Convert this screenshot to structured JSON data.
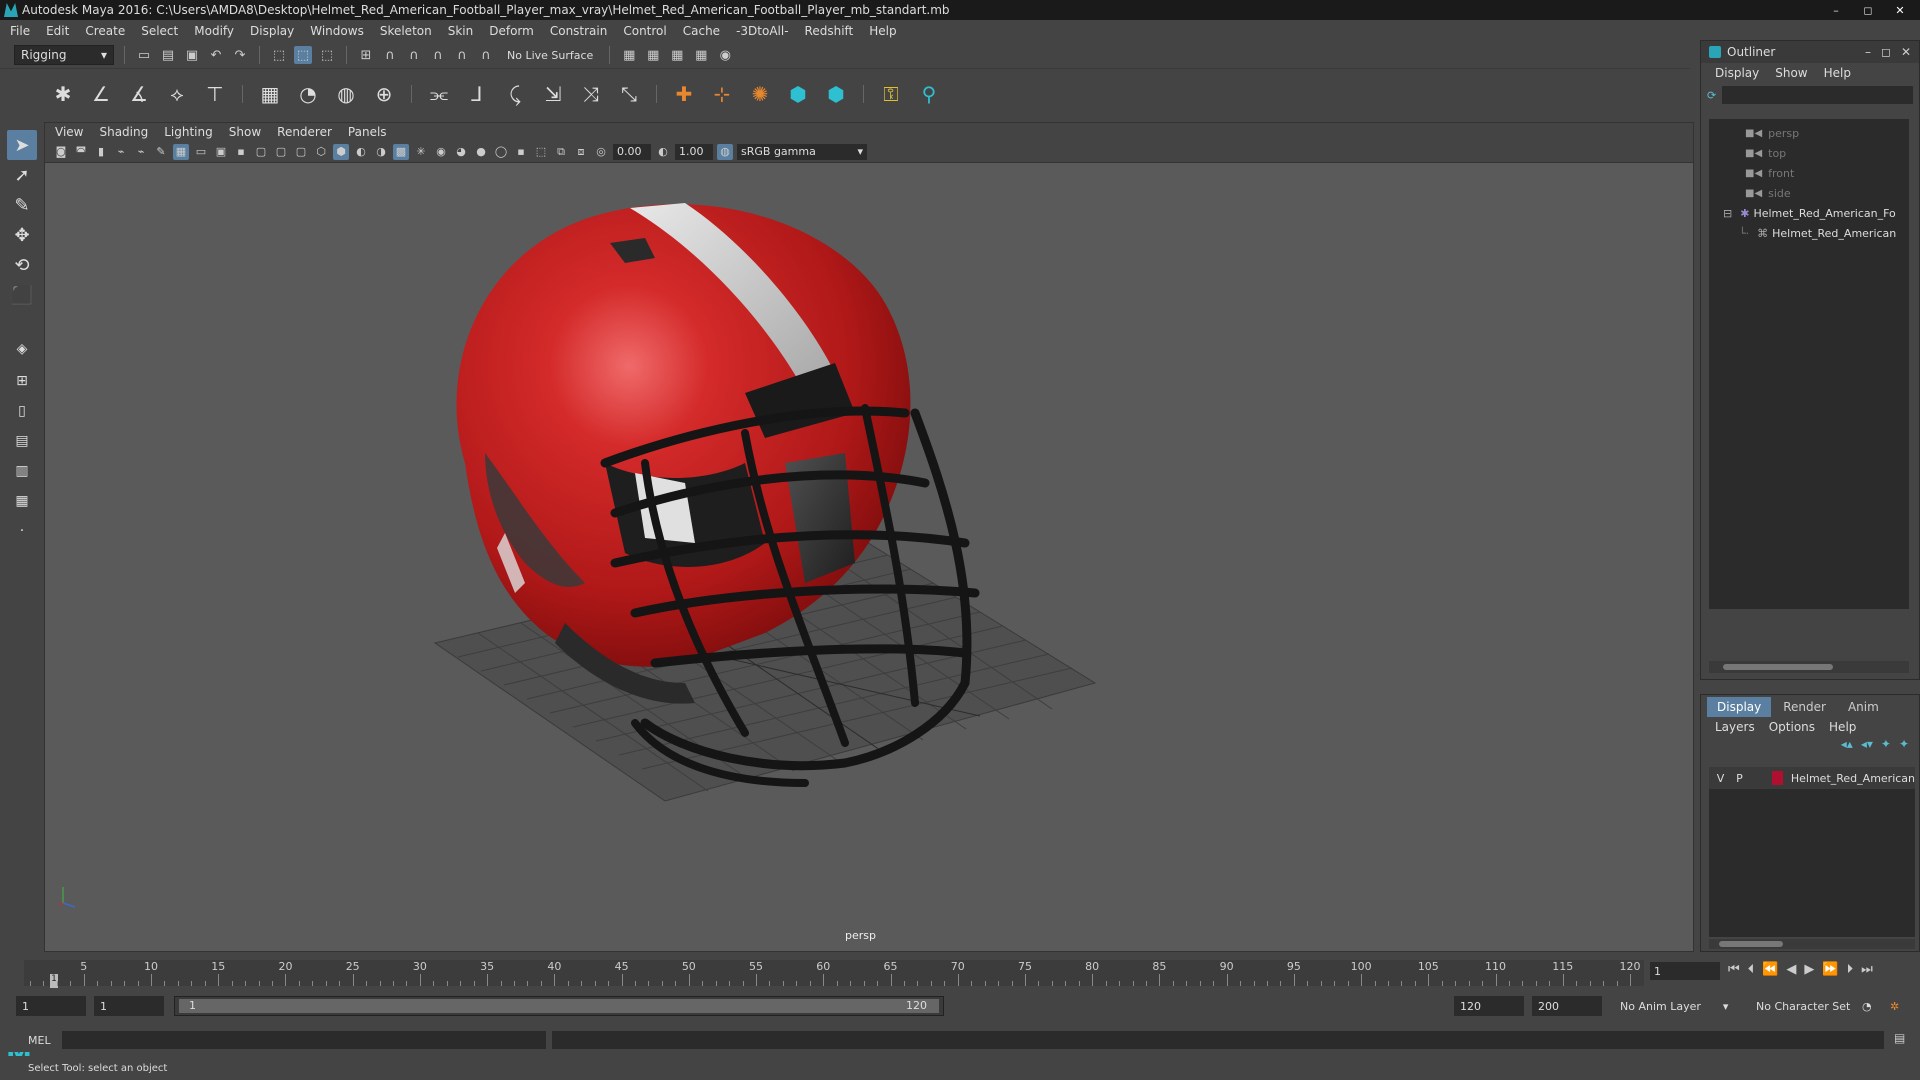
{
  "window": {
    "title": "Autodesk Maya 2016: C:\\Users\\AMDA8\\Desktop\\Helmet_Red_American_Football_Player_max_vray\\Helmet_Red_American_Football_Player_mb_standart.mb",
    "minimize": "–",
    "maximize": "◻",
    "close": "✕"
  },
  "menubar": [
    "File",
    "Edit",
    "Create",
    "Select",
    "Modify",
    "Display",
    "Windows",
    "Skeleton",
    "Skin",
    "Deform",
    "Constrain",
    "Control",
    "Cache",
    "-3DtoAll-",
    "Redshift",
    "Help"
  ],
  "toolbar": {
    "mode": "Rigging",
    "live_surface": "No Live Surface"
  },
  "viewport": {
    "menu": [
      "View",
      "Shading",
      "Lighting",
      "Show",
      "Renderer",
      "Panels"
    ],
    "exposure": "0.00",
    "gamma_value": "1.00",
    "color_space": "sRGB gamma",
    "camera_label": "persp"
  },
  "outliner": {
    "title": "Outliner",
    "menu": [
      "Display",
      "Show",
      "Help"
    ],
    "items": [
      {
        "label": "persp",
        "kind": "camera"
      },
      {
        "label": "top",
        "kind": "camera"
      },
      {
        "label": "front",
        "kind": "camera"
      },
      {
        "label": "side",
        "kind": "camera"
      },
      {
        "label": "Helmet_Red_American_Fo",
        "kind": "group"
      },
      {
        "label": "Helmet_Red_American",
        "kind": "mesh"
      }
    ]
  },
  "layers": {
    "tabs": [
      "Display",
      "Render",
      "Anim"
    ],
    "active_tab": "Display",
    "menu": [
      "Layers",
      "Options",
      "Help"
    ],
    "rows": [
      {
        "v": "V",
        "p": "P",
        "name": "Helmet_Red_American",
        "color": "#b01030"
      }
    ]
  },
  "timeline": {
    "ticks": [
      "5",
      "10",
      "15",
      "20",
      "25",
      "30",
      "35",
      "40",
      "45",
      "50",
      "55",
      "60",
      "65",
      "70",
      "75",
      "80",
      "85",
      "90",
      "95",
      "100",
      "105",
      "110",
      "115",
      "120"
    ],
    "current_frame_marker": "1",
    "current_frame": "1"
  },
  "range": {
    "start": "1",
    "playback_start": "1",
    "slider_start": "1",
    "slider_end": "120",
    "playback_end": "120",
    "end": "200",
    "anim_layer": "No Anim Layer",
    "character_set": "No Character Set"
  },
  "command_line": {
    "label": "MEL"
  },
  "help_line": "Select Tool: select an object",
  "colors": {
    "helmet": "#c81c1c",
    "accent": "#5a7fa0",
    "layer_swatch": "#b01030"
  }
}
